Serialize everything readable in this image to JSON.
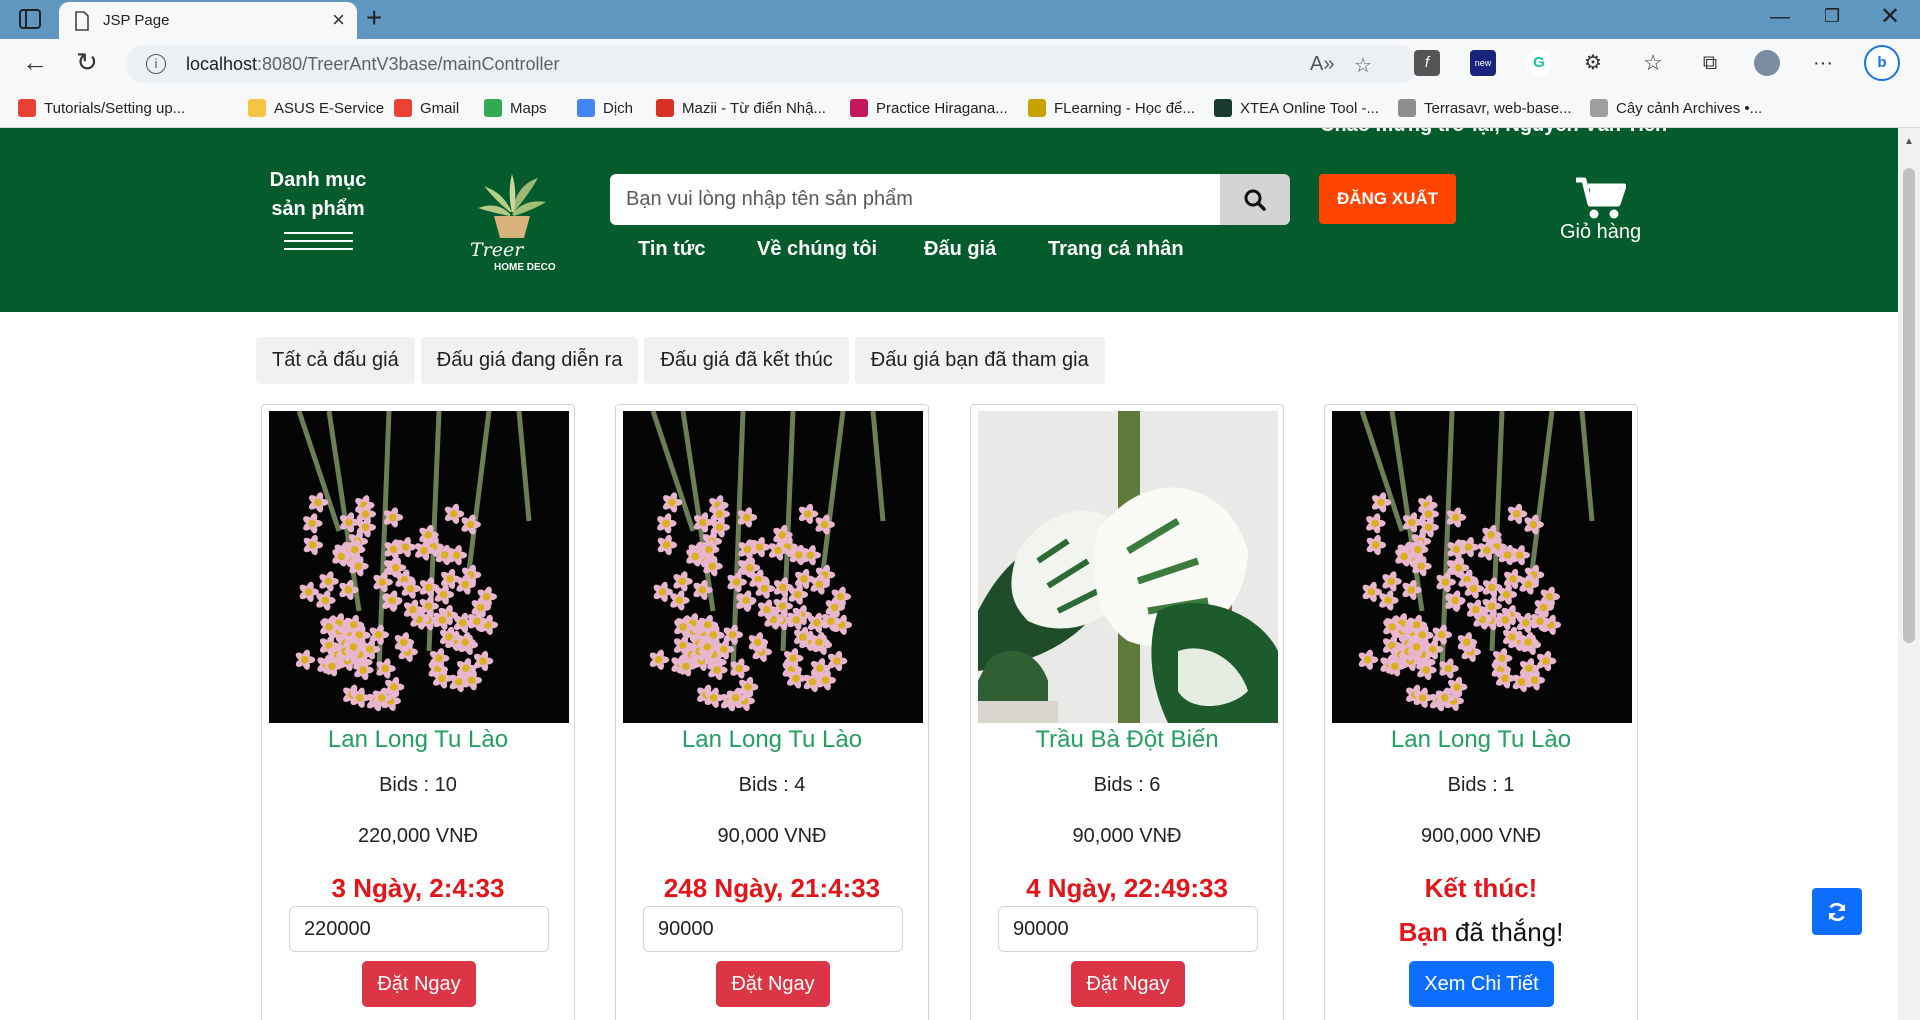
{
  "browser": {
    "tab_title": "JSP Page",
    "url_host": "localhost",
    "url_path": ":8080/TreerAntV3base/mainController",
    "bookmarks": [
      {
        "label": "Tutorials/Setting up...",
        "color": "#e94235"
      },
      {
        "label": "ASUS E-Service",
        "color": "#f6c445"
      },
      {
        "label": "Gmail",
        "color": "#ea4335"
      },
      {
        "label": "Maps",
        "color": "#34a853"
      },
      {
        "label": "Dịch",
        "color": "#4285f4"
      },
      {
        "label": "Mazii - Từ điển Nhậ...",
        "color": "#d93025"
      },
      {
        "label": "Practice Hiragana...",
        "color": "#c2185b"
      },
      {
        "label": "FLearning - Học để...",
        "color": "#c8a200"
      },
      {
        "label": "XTEA Online Tool -...",
        "color": "#1b3a2e"
      },
      {
        "label": "Terrasavr, web-base...",
        "color": "#8e8e8e"
      },
      {
        "label": "Cây cảnh Archives •...",
        "color": "#9e9e9e"
      }
    ]
  },
  "header": {
    "welcome": "Chào mừng trở lại, Nguyễn Văn Tiến",
    "category_line1": "Danh mục",
    "category_line2": "sản phẩm",
    "logo_text": "Treer",
    "logo_sub": "HOME DECO",
    "search_placeholder": "Bạn vui lòng nhập tên sản phẩm",
    "nav": [
      "Tin tức",
      "Về chúng tôi",
      "Đấu giá",
      "Trang cá nhân"
    ],
    "logout": "ĐĂNG XUẤT",
    "cart": "Giỏ hàng"
  },
  "filters": [
    "Tất cả đấu giá",
    "Đấu giá đang diễn ra",
    "Đấu giá đã kết thúc",
    "Đấu giá bạn đã tham gia"
  ],
  "cards": [
    {
      "name": "Lan Long Tu Lào",
      "bids": "Bids : 10",
      "price": "220,000 VNĐ",
      "timer": "3 Ngày, 2:4:33",
      "input": "220000",
      "button": "Đặt Ngay",
      "image": "orchid"
    },
    {
      "name": "Lan Long Tu Lào",
      "bids": "Bids : 4",
      "price": "90,000 VNĐ",
      "timer": "248 Ngày, 21:4:33",
      "input": "90000",
      "button": "Đặt Ngay",
      "image": "orchid"
    },
    {
      "name": "Trầu Bà Đột Biến",
      "bids": "Bids : 6",
      "price": "90,000 VNĐ",
      "timer": "4 Ngày, 22:49:33",
      "input": "90000",
      "button": "Đặt Ngay",
      "image": "monstera"
    },
    {
      "name": "Lan Long Tu Lào",
      "bids": "Bids : 1",
      "price": "900,000 VNĐ",
      "ended": "Kết thúc!",
      "winner_bold": "Bạn",
      "winner_rest": " đã thắng!",
      "button": "Xem Chi Tiết",
      "image": "orchid"
    }
  ]
}
